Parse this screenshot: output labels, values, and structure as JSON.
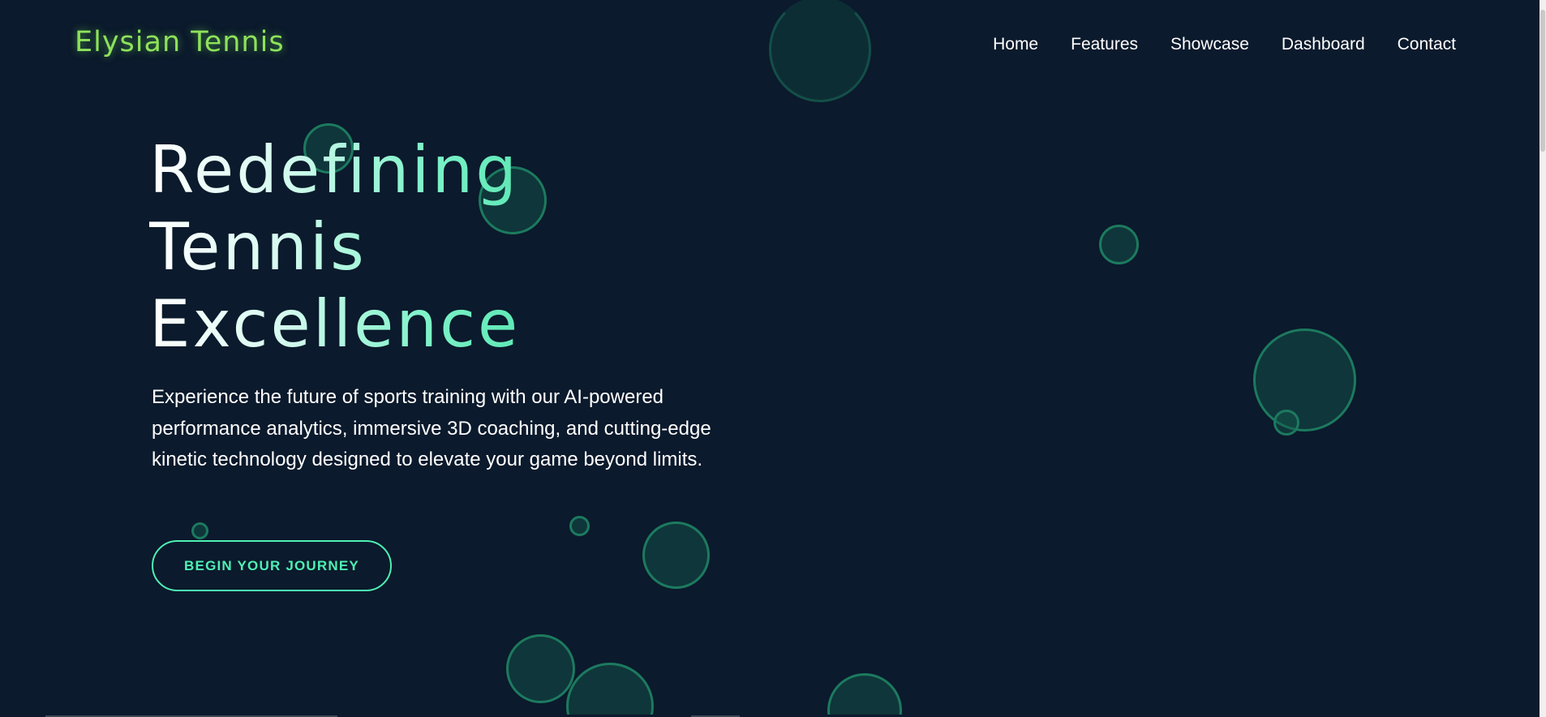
{
  "brand": {
    "logo_text": "Elysian Tennis",
    "logo_color": "#8ee25a",
    "accent_color": "#4ef0b3",
    "background_color": "#0b1a2c"
  },
  "nav": {
    "items": [
      {
        "label": "Home"
      },
      {
        "label": "Features"
      },
      {
        "label": "Showcase"
      },
      {
        "label": "Dashboard"
      },
      {
        "label": "Contact"
      }
    ]
  },
  "hero": {
    "title_lines": [
      "Redefining",
      "Tennis",
      "Excellence"
    ],
    "description": "Experience the future of sports training with our AI-powered performance analytics, immersive 3D coaching, and cutting-edge kinetic technology designed to elevate your game beyond limits.",
    "cta_label": "BEGIN YOUR JOURNEY"
  }
}
